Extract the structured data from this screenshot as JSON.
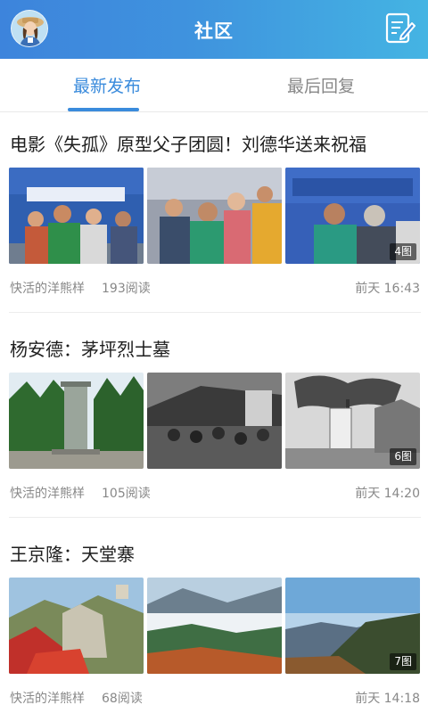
{
  "header": {
    "title": "社区",
    "avatar_icon": "girl-avatar-icon",
    "compose_icon": "compose-icon"
  },
  "tabs": [
    {
      "label": "最新发布",
      "active": true
    },
    {
      "label": "最后回复",
      "active": false
    }
  ],
  "colors": {
    "header_start": "#3d84dc",
    "header_end": "#44b4e3",
    "accent": "#3a8bdc",
    "muted": "#888888"
  },
  "posts": [
    {
      "title": "电影《失孤》原型父子团圆！刘德华送来祝福",
      "author": "快活的洋熊样",
      "reads": "193阅读",
      "time": "前天 16:43",
      "image_count": "4图"
    },
    {
      "title": "杨安德：茅坪烈士墓",
      "author": "快活的洋熊样",
      "reads": "105阅读",
      "time": "前天 14:20",
      "image_count": "6图"
    },
    {
      "title": "王京隆：天堂寨",
      "author": "快活的洋熊样",
      "reads": "68阅读",
      "time": "前天 14:18",
      "image_count": "7图"
    }
  ]
}
